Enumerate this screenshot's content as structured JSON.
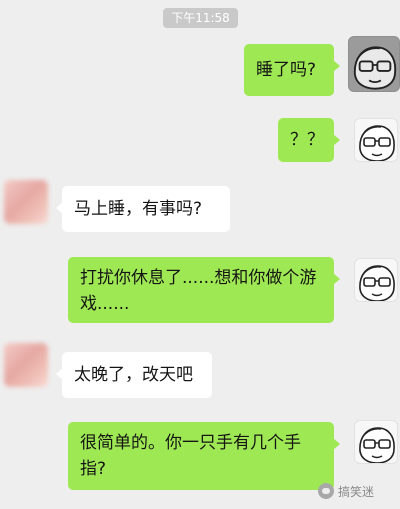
{
  "status": {
    "time": "下午11:58"
  },
  "messages": [
    {
      "from": "me",
      "text": "睡了吗?"
    },
    {
      "from": "me",
      "text": "？？"
    },
    {
      "from": "other",
      "text": "马上睡，有事吗?"
    },
    {
      "from": "me",
      "text": "打扰你休息了......想和你做个游戏......"
    },
    {
      "from": "other",
      "text": "太晚了，改天吧"
    },
    {
      "from": "me",
      "text": "很简单的。你一只手有几个手指?"
    }
  ],
  "avatars": {
    "me": "glasses-face-icon",
    "other": "blurred-avatar"
  },
  "watermark": {
    "text": "搞笑迷"
  },
  "colors": {
    "bubble_me": "#9ee953",
    "bubble_other": "#ffffff",
    "background": "#eeeeee"
  }
}
